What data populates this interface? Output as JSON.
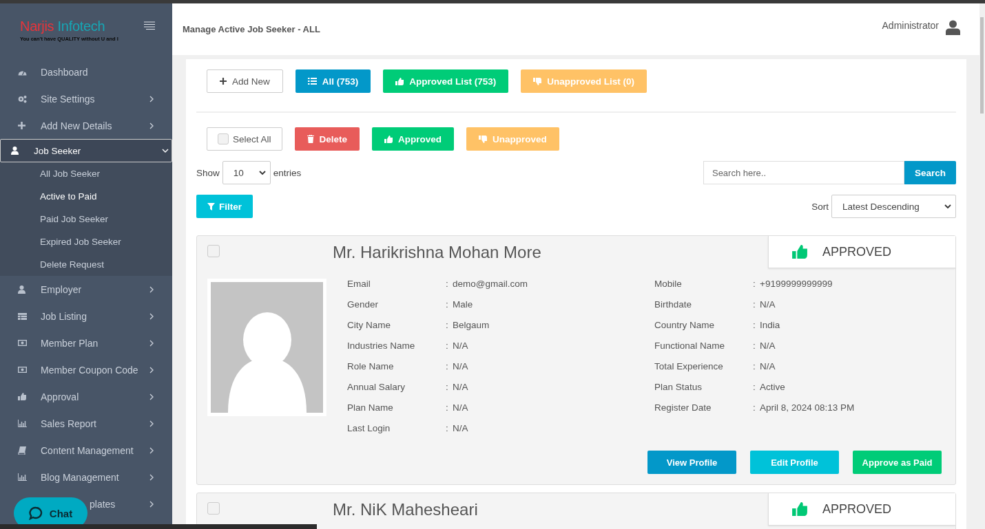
{
  "sidebar": {
    "logo": {
      "first": "Narjis",
      "second": "Infotech",
      "tagline": "You can't have QUALITY without U and I"
    },
    "items": [
      {
        "label": "Dashboard",
        "has_submenu": false,
        "selected": false
      },
      {
        "label": "Site Settings",
        "has_submenu": true,
        "expanded": false,
        "selected": false
      },
      {
        "label": "Add New Details",
        "has_submenu": true,
        "expanded": false,
        "selected": false
      },
      {
        "label": "Job Seeker",
        "has_submenu": true,
        "expanded": true,
        "selected": true,
        "children": [
          {
            "label": "All Job Seeker",
            "selected": false
          },
          {
            "label": "Active to Paid",
            "selected": true
          },
          {
            "label": "Paid Job Seeker",
            "selected": false
          },
          {
            "label": "Expired Job Seeker",
            "selected": false
          },
          {
            "label": "Delete Request",
            "selected": false
          }
        ]
      },
      {
        "label": "Employer",
        "has_submenu": true,
        "expanded": false,
        "selected": false
      },
      {
        "label": "Job Listing",
        "has_submenu": true,
        "expanded": false,
        "selected": false
      },
      {
        "label": "Member Plan",
        "has_submenu": true,
        "expanded": false,
        "selected": false
      },
      {
        "label": "Member Coupon Code",
        "has_submenu": true,
        "expanded": false,
        "selected": false
      },
      {
        "label": "Approval",
        "has_submenu": true,
        "expanded": false,
        "selected": false
      },
      {
        "label": "Sales Report",
        "has_submenu": true,
        "expanded": false,
        "selected": false
      },
      {
        "label": "Content Management",
        "has_submenu": true,
        "expanded": false,
        "selected": false
      },
      {
        "label": "Blog Management",
        "has_submenu": true,
        "expanded": false,
        "selected": false
      },
      {
        "label": "plates",
        "has_submenu": true,
        "expanded": false,
        "selected": false,
        "covered": true
      }
    ]
  },
  "header": {
    "title": "Manage Active Job Seeker - ALL",
    "user": "Administrator"
  },
  "list_buttons": [
    {
      "label": "Add New",
      "kind": "add"
    },
    {
      "label": "All (753)",
      "kind": "all"
    },
    {
      "label": "Approved List (753)",
      "kind": "approved"
    },
    {
      "label": "Unapproved List (0)",
      "kind": "unapproved"
    }
  ],
  "bulk_actions": [
    {
      "label": "Select All",
      "kind": "select",
      "checked": false
    },
    {
      "label": "Delete",
      "kind": "delete"
    },
    {
      "label": "Approved",
      "kind": "approved"
    },
    {
      "label": "Unapproved",
      "kind": "unapproved"
    }
  ],
  "entries": {
    "before": "Show",
    "value": "10",
    "after": "entries"
  },
  "search": {
    "placeholder": "Search here..",
    "button": "Search"
  },
  "filter": {
    "label": "Filter"
  },
  "sort": {
    "label": "Sort",
    "value": "Latest Descending"
  },
  "profiles": [
    {
      "name": "Mr. Harikrishna Mohan More",
      "checked": false,
      "status": "APPROVED",
      "approved": true,
      "left": [
        {
          "label": "Email",
          "sep": ":",
          "value": "demo@gmail.com"
        },
        {
          "label": "Gender",
          "sep": ":",
          "value": "Male"
        },
        {
          "label": "City Name",
          "sep": ":",
          "value": "Belgaum"
        },
        {
          "label": "Industries Name",
          "sep": ":",
          "value": "N/A"
        },
        {
          "label": "Role Name",
          "sep": ":",
          "value": "N/A"
        },
        {
          "label": "Annual Salary",
          "sep": ":",
          "value": "N/A"
        },
        {
          "label": "Plan Name",
          "sep": ":",
          "value": "N/A"
        },
        {
          "label": "Last Login",
          "sep": ":",
          "value": "N/A"
        }
      ],
      "right": [
        {
          "label": "Mobile",
          "sep": ":",
          "value": "+9199999999999"
        },
        {
          "label": "Birthdate",
          "sep": ":",
          "value": "N/A"
        },
        {
          "label": "Country Name",
          "sep": ":",
          "value": "India"
        },
        {
          "label": "Functional Name",
          "sep": ":",
          "value": "N/A"
        },
        {
          "label": "Total Experience",
          "sep": ":",
          "value": "N/A"
        },
        {
          "label": "Plan Status",
          "sep": ":",
          "value": "Active"
        },
        {
          "label": "Register Date",
          "sep": ":",
          "value": "April 8, 2024 08:13 PM"
        }
      ],
      "actions": [
        {
          "label": "View Profile",
          "kind": "view"
        },
        {
          "label": "Edit Profile",
          "kind": "edit"
        },
        {
          "label": "Approve as Paid",
          "kind": "paid"
        }
      ]
    },
    {
      "name": "Mr. NiK Mahesheari",
      "checked": false,
      "status": "APPROVED",
      "approved": true
    }
  ],
  "chat": {
    "label": "Chat"
  }
}
